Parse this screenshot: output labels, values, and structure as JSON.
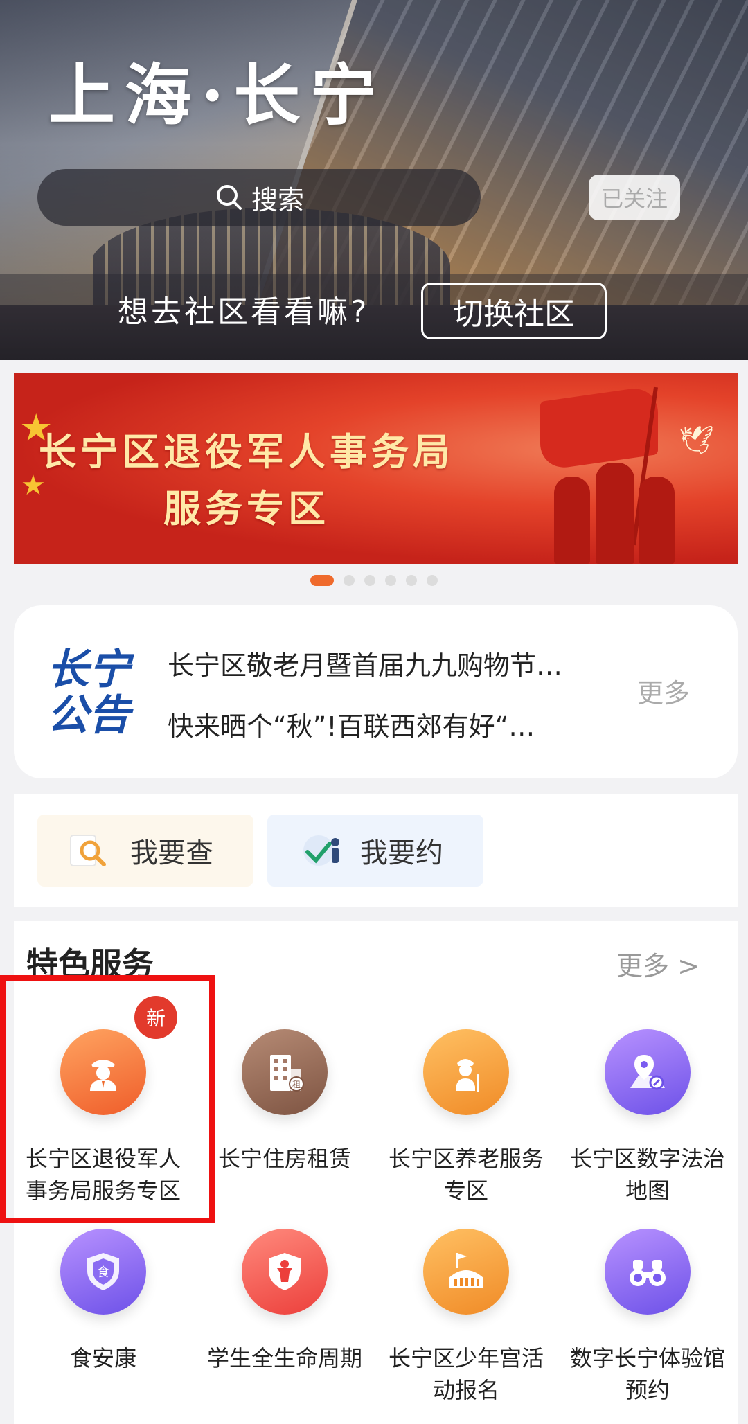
{
  "hero": {
    "title": "上海·长宁",
    "search_placeholder": "搜索",
    "follow_label": "已关注",
    "switch_prompt": "想去社区看看嘛?",
    "switch_button": "切换社区"
  },
  "banner": {
    "line1": "长宁区退役军人事务局",
    "line2": "服务专区",
    "page_count": 6,
    "active_index": 0
  },
  "notice": {
    "logo_line1": "长宁",
    "logo_line2": "公告",
    "items": [
      "长宁区敬老月暨首届九九购物节…",
      "快来晒个“秋”!百联西郊有好“…"
    ],
    "more_label": "更多"
  },
  "quick_actions": [
    {
      "label": "我要查",
      "icon": "magnifier-icon"
    },
    {
      "label": "我要约",
      "icon": "appointment-icon"
    }
  ],
  "services": {
    "title": "特色服务",
    "more_label": "更多 >",
    "new_badge": "新",
    "items": [
      {
        "line1": "长宁区退役军人",
        "line2": "事务局服务专区",
        "icon": "veteran-officer-icon",
        "color": "#ef6a2c"
      },
      {
        "line1": "长宁住房租赁",
        "line2": "",
        "icon": "building-rent-icon",
        "color": "#8d604c"
      },
      {
        "line1": "长宁区养老服务",
        "line2": "专区",
        "icon": "elderly-icon",
        "color": "#f59a3a"
      },
      {
        "line1": "长宁区数字法治",
        "line2": "地图",
        "icon": "map-pin-icon",
        "color": "#7a5cf0"
      },
      {
        "line1": "食安康",
        "line2": "",
        "icon": "food-shield-icon",
        "color": "#7a5cf0"
      },
      {
        "line1": "学生全生命周期",
        "line2": "",
        "icon": "student-shield-icon",
        "color": "#ee4a40"
      },
      {
        "line1": "长宁区少年宫活",
        "line2": "动报名",
        "icon": "stadium-flag-icon",
        "color": "#f59a3a"
      },
      {
        "line1": "数字长宁体验馆",
        "line2": "预约",
        "icon": "binoculars-icon",
        "color": "#7a5cf0"
      }
    ]
  },
  "colors": {
    "accent": "#ef6a2c",
    "highlight_border": "#ee1111",
    "badge": "#e23a2c"
  }
}
